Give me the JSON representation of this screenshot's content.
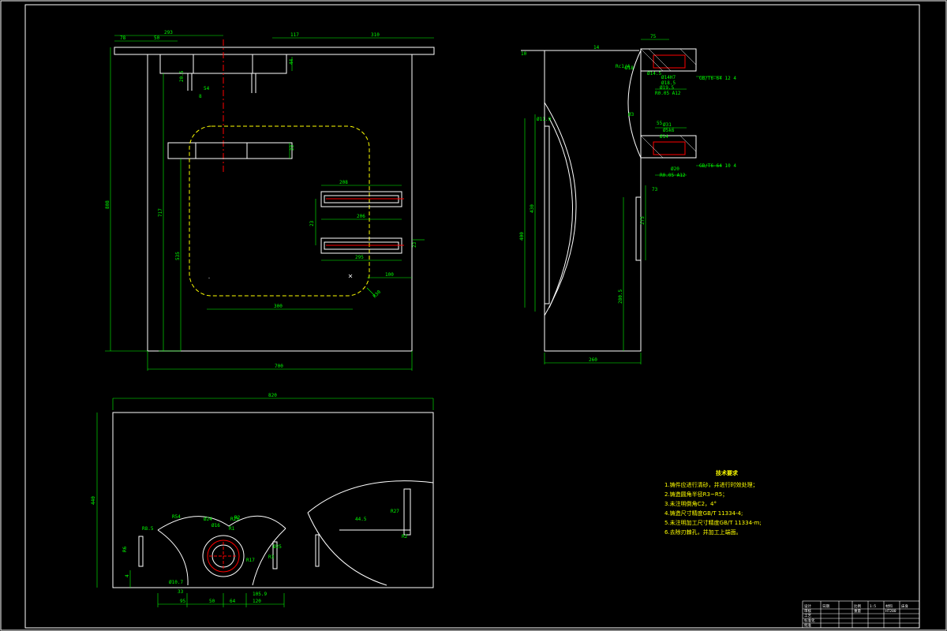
{
  "colors": {
    "background": "#000000",
    "outline": "#ffffff",
    "dimension": "#00ff00",
    "hidden": "#ffff00",
    "center": "#ff0000",
    "notes": "#ffff00"
  },
  "front_view": {
    "dims": [
      "293",
      "78",
      "50",
      "117",
      "310",
      "808",
      "717",
      "535",
      "44",
      "20.5",
      "54",
      "8",
      "208",
      "23",
      "206",
      "23",
      "295",
      "23",
      "100",
      "300",
      "R30",
      "700"
    ]
  },
  "side_view": {
    "dims": [
      "75",
      "10",
      "14",
      "Rc1/4",
      "Ø14H7",
      "Ø18.5",
      "Ø19.5",
      "R0.05 A12",
      "Ø14.5",
      "Ø31",
      "Ø5k6",
      "Ø14",
      "Ø20",
      "R0.05 A12",
      "Ø18",
      "Ø3",
      "Ø11.9",
      "73",
      "430",
      "400",
      "275",
      "280.5",
      "260",
      "55"
    ],
    "callouts": [
      "GB/T6-64 12 4",
      "GB/T6-64 10 4"
    ]
  },
  "bottom_view": {
    "dims": [
      "820",
      "440",
      "R54",
      "Ø24",
      "Ø16",
      "R1",
      "R2",
      "R8.5",
      "R17",
      "R25",
      "Ø25",
      "R3",
      "Ø10.7",
      "33",
      "R6",
      "4",
      "95",
      "50",
      "64",
      "120",
      "44.5",
      "R27",
      "105.9",
      "R2"
    ]
  },
  "technical_requirements": {
    "title": "技术要求",
    "items": [
      "1.铸件应进行清砂，并进行时效处理；",
      "2.铸造圆角半径R3~R5；",
      "3.未注明倒角C2，4°",
      "4.铸造尺寸精度GB/T 11334-4;",
      "5.未注明加工尺寸精度GB/T 11334-m;",
      "6.去除刃棘孔，并加工上端面。"
    ]
  },
  "title_block": {
    "cells": [
      "设计",
      "审核",
      "工艺",
      "标准化",
      "批准",
      "日期",
      "比例",
      "1:5",
      "重量",
      "材料",
      "HT200",
      "床身"
    ]
  }
}
